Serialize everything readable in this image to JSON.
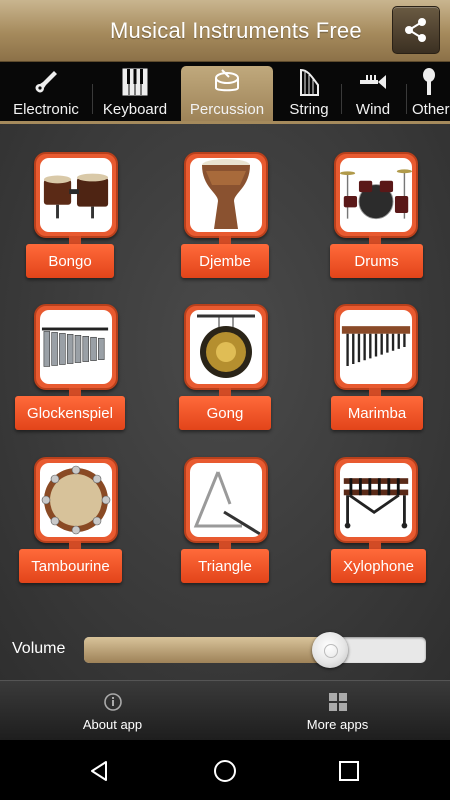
{
  "header": {
    "title": "Musical Instruments Free",
    "share_icon": "share-icon"
  },
  "tabs": [
    {
      "label": "Electronic",
      "icon": "electric-guitar-icon"
    },
    {
      "label": "Keyboard",
      "icon": "piano-keys-icon"
    },
    {
      "label": "Percussion",
      "icon": "drum-icon",
      "active": true
    },
    {
      "label": "String",
      "icon": "harp-icon"
    },
    {
      "label": "Wind",
      "icon": "trumpet-icon"
    },
    {
      "label": "Other",
      "icon": "microphone-icon"
    }
  ],
  "instruments": [
    {
      "label": "Bongo"
    },
    {
      "label": "Djembe"
    },
    {
      "label": "Drums"
    },
    {
      "label": "Glockenspiel"
    },
    {
      "label": "Gong"
    },
    {
      "label": "Marimba"
    },
    {
      "label": "Tambourine"
    },
    {
      "label": "Triangle"
    },
    {
      "label": "Xylophone"
    }
  ],
  "volume": {
    "label": "Volume",
    "level": 0.72
  },
  "bottom_bar": {
    "about": {
      "label": "About app",
      "icon": "info-icon"
    },
    "more": {
      "label": "More apps",
      "icon": "grid-icon"
    }
  },
  "navigation": {
    "back_icon": "back-icon",
    "home_icon": "home-icon",
    "recents_icon": "recents-icon"
  },
  "colors": {
    "accent_gold": "#a58a5c",
    "button_orange": "#e85a30",
    "background": "#3a3a3a"
  }
}
